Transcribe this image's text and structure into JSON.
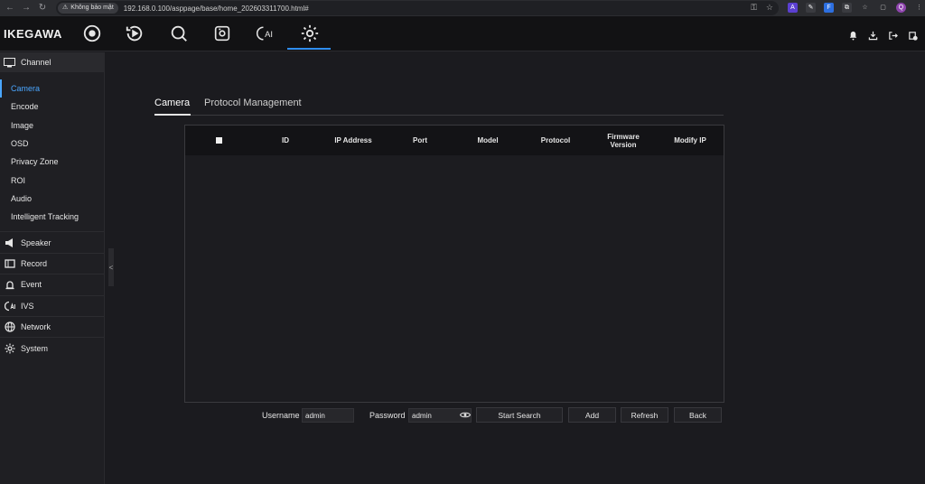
{
  "browser": {
    "insecure_label": "Không bảo mật",
    "url": "192.168.0.100/asppage/base/home_202603311700.html#"
  },
  "app": {
    "logo": "IKEGAWA",
    "nav_icons": [
      "live-view-icon",
      "playback-icon",
      "search-icon",
      "smart-icon",
      "ai-icon",
      "settings-icon"
    ],
    "active_nav": "settings-icon",
    "nav_ai_label": "AI",
    "right_icons": [
      "bell-icon",
      "download-icon",
      "logout-icon",
      "info-icon"
    ]
  },
  "sidebar": {
    "channel_label": "Channel",
    "channel_items": [
      {
        "label": "Camera",
        "active": true
      },
      {
        "label": "Encode"
      },
      {
        "label": "Image"
      },
      {
        "label": "OSD"
      },
      {
        "label": "Privacy Zone"
      },
      {
        "label": "ROI"
      },
      {
        "label": "Audio"
      },
      {
        "label": "Intelligent Tracking"
      }
    ],
    "groups": [
      "Speaker",
      "Record",
      "Event",
      "IVS",
      "Network",
      "System"
    ]
  },
  "tabs": [
    {
      "label": "Camera",
      "active": true
    },
    {
      "label": "Protocol Management"
    }
  ],
  "table": {
    "columns": [
      "ID",
      "IP Address",
      "Port",
      "Model",
      "Protocol",
      "Firmware Version",
      "Modify IP"
    ],
    "rows": []
  },
  "footer": {
    "username_label": "Username",
    "username_value": "admin",
    "password_label": "Password",
    "password_value": "admin",
    "start_search": "Start Search",
    "add": "Add",
    "refresh": "Refresh",
    "back": "Back"
  },
  "colors": {
    "accent": "#2f8ef0",
    "active_text": "#4aa6ff"
  }
}
